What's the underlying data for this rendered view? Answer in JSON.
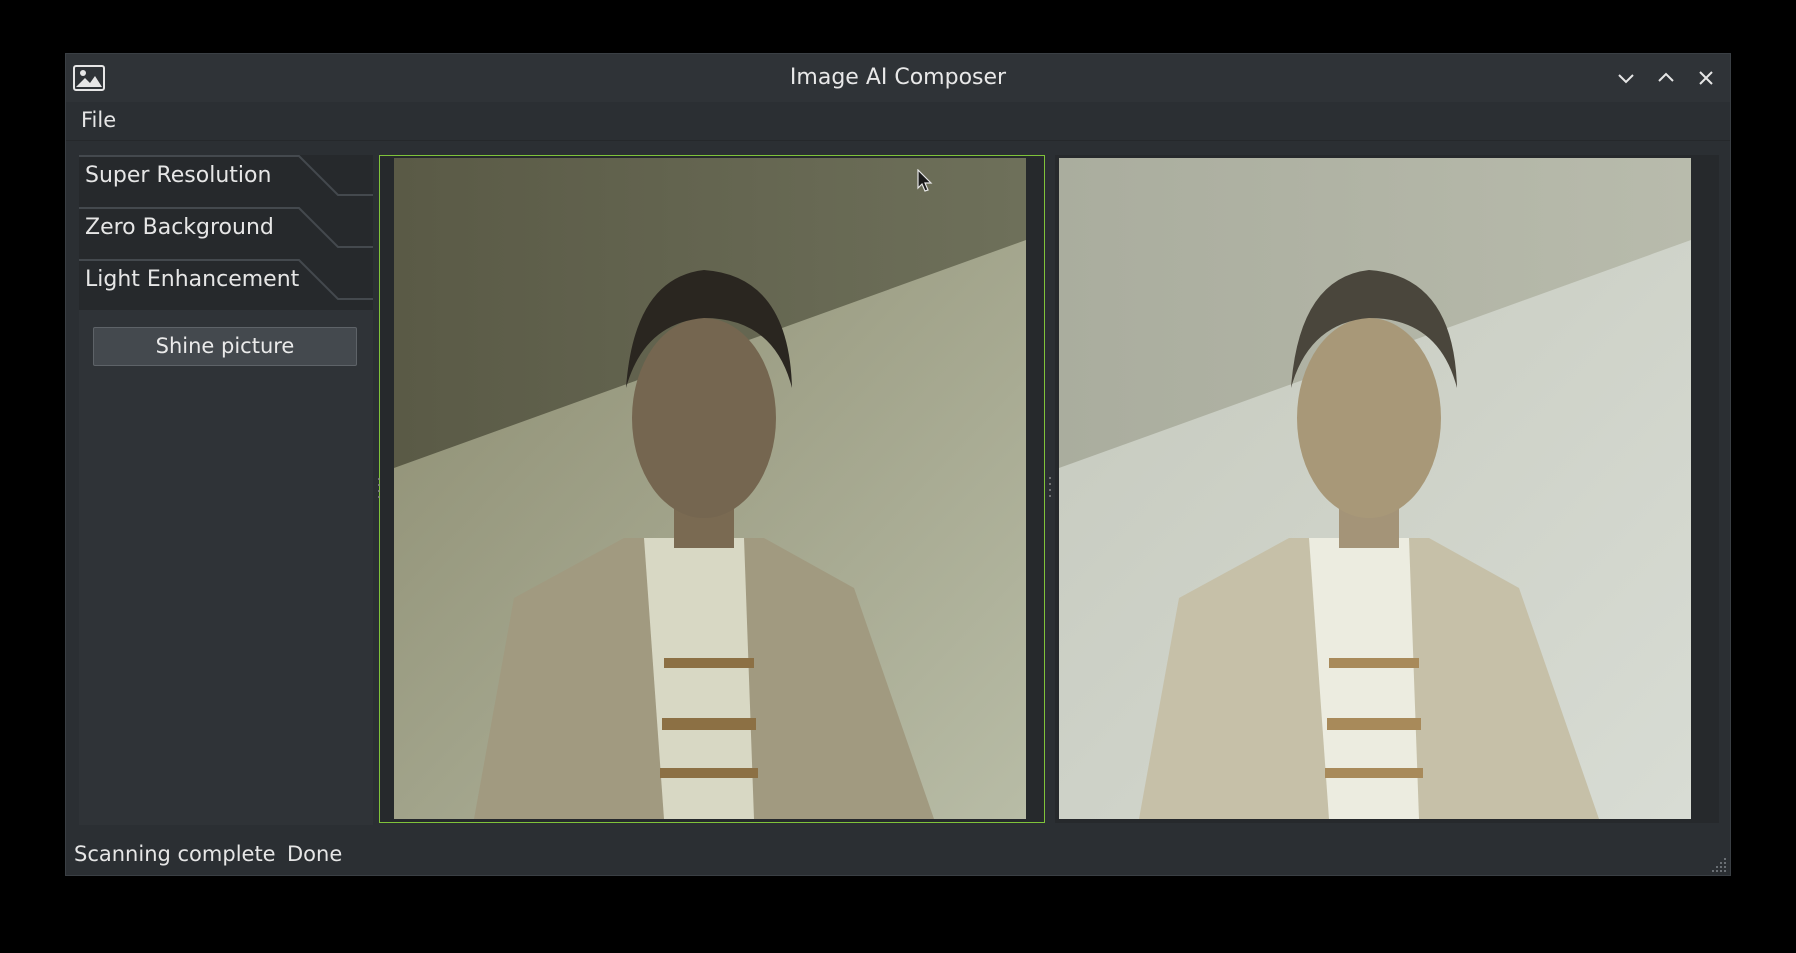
{
  "window": {
    "title": "Image AI Composer",
    "icon": "image-icon",
    "controls": [
      "minimize-icon",
      "maximize-icon",
      "close-icon"
    ]
  },
  "menubar": {
    "file": "File"
  },
  "sidebar": {
    "tabs": [
      {
        "label": "Super Resolution"
      },
      {
        "label": "Zero Background"
      },
      {
        "label": "Light Enhancement"
      }
    ],
    "active_tab": "Light Enhancement",
    "action_button": "Shine picture"
  },
  "viewers": {
    "input": {
      "description_icon": "input-photo",
      "selected": true
    },
    "output": {
      "description_icon": "output-photo",
      "selected": false
    }
  },
  "status": {
    "message": "Scanning complete",
    "result": "Done"
  },
  "colors": {
    "accent_border": "#7fc33a",
    "window_bg": "#2b2f33",
    "panel_bg": "#26292c"
  }
}
